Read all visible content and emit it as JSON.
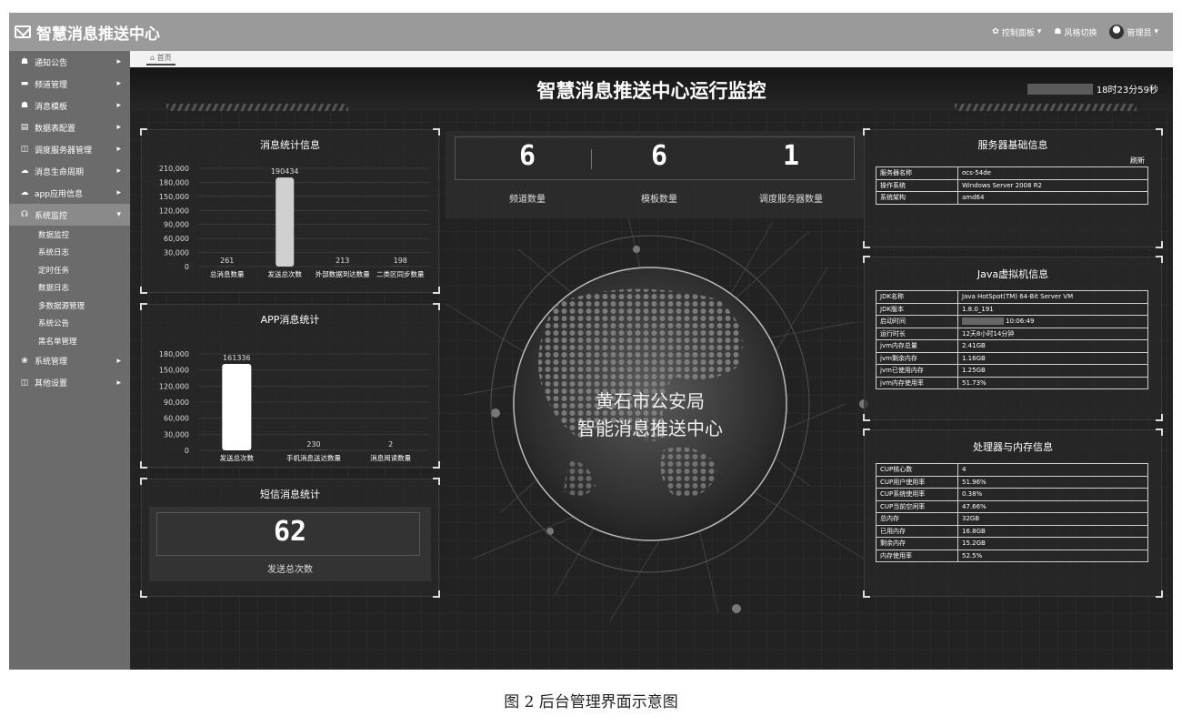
{
  "app": {
    "title": "智慧消息推送中心",
    "top_menu": [
      {
        "label": "控制面板",
        "icon": "dashboard-icon"
      },
      {
        "label": "风格切换",
        "icon": "palette-icon"
      },
      {
        "label": "管理员",
        "icon": "avatar-icon"
      }
    ]
  },
  "sidebar": {
    "items": [
      {
        "label": "通知公告",
        "icon": "shirt-icon"
      },
      {
        "label": "频道管理",
        "icon": "list-icon"
      },
      {
        "label": "消息模板",
        "icon": "shirt-icon"
      },
      {
        "label": "数据表配置",
        "icon": "doc-icon"
      },
      {
        "label": "调度服务器管理",
        "icon": "columns-icon"
      },
      {
        "label": "消息生命周期",
        "icon": "cloud-icon"
      },
      {
        "label": "app应用信息",
        "icon": "cloud-icon"
      },
      {
        "label": "系统监控",
        "icon": "headset-icon"
      },
      {
        "label": "系统管理",
        "icon": "bolt-icon"
      },
      {
        "label": "其他设置",
        "icon": "columns-icon"
      }
    ],
    "active_index": 7,
    "sub_items": [
      "数据监控",
      "系统日志",
      "定时任务",
      "数据日志",
      "多数据源管理",
      "系统公告",
      "黑名单管理"
    ]
  },
  "tabs": {
    "home": "首页"
  },
  "dashboard": {
    "title": "智慧消息推送中心运行监控",
    "clock": "18时23分59秒"
  },
  "msg_stats": {
    "title": "消息统计信息",
    "chart_data": {
      "type": "bar",
      "categories": [
        "总消息数量",
        "发送总次数",
        "外部数据到达数量",
        "二类区同步数量"
      ],
      "values": [
        261,
        190434,
        213,
        198
      ],
      "y_ticks": [
        "0",
        "30,000",
        "60,000",
        "90,000",
        "120,000",
        "150,000",
        "180,000",
        "210,000"
      ],
      "ylim": [
        0,
        210000
      ]
    }
  },
  "app_stats": {
    "title": "APP消息统计",
    "chart_data": {
      "type": "bar",
      "categories": [
        "发送总次数",
        "手机消息送达数量",
        "消息阅读数量"
      ],
      "values": [
        161336,
        230,
        2
      ],
      "y_ticks": [
        "0",
        "30,000",
        "60,000",
        "90,000",
        "120,000",
        "150,000",
        "180,000"
      ],
      "ylim": [
        0,
        180000
      ]
    }
  },
  "sms_stats": {
    "title": "短信消息统计",
    "value": "62",
    "label": "发送总次数"
  },
  "counters": [
    {
      "value": "6",
      "label": "频道数量"
    },
    {
      "value": "6",
      "label": "模板数量"
    },
    {
      "value": "1",
      "label": "调度服务器数量"
    }
  ],
  "globe": {
    "line1": "黄石市公安局",
    "line2": "智能消息推送中心"
  },
  "server_info": {
    "title": "服务器基础信息",
    "refresh": "刷新",
    "rows": [
      {
        "k": "服务器名称",
        "v": "ocs-54de"
      },
      {
        "k": "操作系统",
        "v": "Windows Server 2008 R2"
      },
      {
        "k": "系统架构",
        "v": "amd64"
      }
    ]
  },
  "jvm_info": {
    "title": "Java虚拟机信息",
    "rows": [
      {
        "k": "JDK名称",
        "v": "Java HotSpot(TM) 64-Bit Server VM"
      },
      {
        "k": "JDK版本",
        "v": "1.8.0_191"
      },
      {
        "k": "启动时间",
        "v": "10:06:49"
      },
      {
        "k": "运行时长",
        "v": "12天8小时14分钟"
      },
      {
        "k": "jvm内存总量",
        "v": "2.41GB"
      },
      {
        "k": "jvm剩余内存",
        "v": "1.16GB"
      },
      {
        "k": "jvm已使用内存",
        "v": "1.25GB"
      },
      {
        "k": "jvm内存使用率",
        "v": "51.73%"
      }
    ]
  },
  "cpu_info": {
    "title": "处理器与内存信息",
    "rows": [
      {
        "k": "CUP核心数",
        "v": "4"
      },
      {
        "k": "CUP用户使用率",
        "v": "51.96%"
      },
      {
        "k": "CUP系统使用率",
        "v": "0.38%"
      },
      {
        "k": "CUP当前空闲率",
        "v": "47.66%"
      },
      {
        "k": "总内存",
        "v": "32GB"
      },
      {
        "k": "已用内存",
        "v": "16.8GB"
      },
      {
        "k": "剩余内存",
        "v": "15.2GB"
      },
      {
        "k": "内存使用率",
        "v": "52.5%"
      }
    ]
  },
  "caption": "图 2   后台管理界面示意图"
}
